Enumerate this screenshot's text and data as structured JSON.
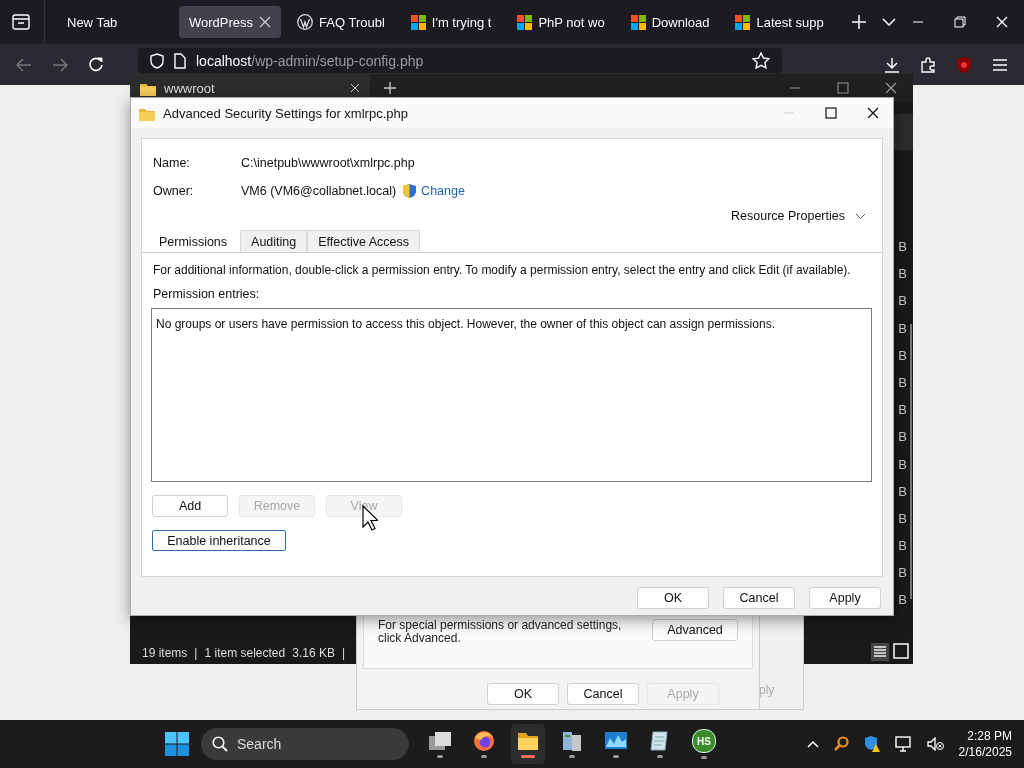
{
  "browser": {
    "tabs": [
      {
        "label": "New Tab",
        "selected": false,
        "kind": "plain"
      },
      {
        "label": "WordPress",
        "selected": true,
        "kind": "plain"
      },
      {
        "label": "FAQ Troubl",
        "selected": false,
        "kind": "wordpress"
      },
      {
        "label": "I'm trying t",
        "selected": false,
        "kind": "microsoft"
      },
      {
        "label": "PhP not wo",
        "selected": false,
        "kind": "microsoft"
      },
      {
        "label": "Download",
        "selected": false,
        "kind": "microsoft"
      },
      {
        "label": "Latest supp",
        "selected": false,
        "kind": "microsoft"
      }
    ],
    "url": {
      "host": "localhost",
      "path": "/wp-admin/setup-config.php"
    }
  },
  "explorer": {
    "tab_title": "wwwroot",
    "status": [
      "19 items",
      "1 item selected",
      "3.16 KB"
    ],
    "status_dividers": [
      "|",
      "|"
    ],
    "size_fragments": [
      "B",
      "B",
      "B",
      "B",
      "B",
      "B",
      "B",
      "B",
      "B",
      "B",
      "B",
      "B",
      "B",
      "B"
    ]
  },
  "dialog": {
    "title": "Advanced Security Settings for xmlrpc.php",
    "name_label": "Name:",
    "name_value": "C:\\inetpub\\wwwroot\\xmlrpc.php",
    "owner_label": "Owner:",
    "owner_value": "VM6 (VM6@collabnet.local)",
    "change_link": "Change",
    "resource_properties": "Resource Properties",
    "tabs": [
      {
        "label": "Permissions",
        "selected": true
      },
      {
        "label": "Auditing",
        "selected": false
      },
      {
        "label": "Effective Access",
        "selected": false
      }
    ],
    "info": "For additional information, double-click a permission entry. To modify a permission entry, select the entry and click Edit (if available).",
    "entries_label": "Permission entries:",
    "entries_message": "No groups or users have permission to access this object. However, the owner of this object can assign permissions.",
    "entry_buttons": [
      {
        "label": "Add",
        "disabled": false
      },
      {
        "label": "Remove",
        "disabled": true
      },
      {
        "label": "View",
        "disabled": true
      }
    ],
    "inheritance_button": "Enable inheritance",
    "footer_buttons": [
      {
        "label": "OK",
        "disabled": false
      },
      {
        "label": "Cancel",
        "disabled": false
      },
      {
        "label": "Apply",
        "disabled": false
      }
    ]
  },
  "properties_dialog": {
    "message": "For special permissions or advanced settings, click Advanced.",
    "advanced_button": "Advanced",
    "buttons": [
      {
        "label": "OK",
        "disabled": false
      },
      {
        "label": "Cancel",
        "disabled": false
      },
      {
        "label": "Apply",
        "disabled": true
      }
    ],
    "behind_fragment": "ply"
  },
  "taskbar": {
    "search_placeholder": "Search",
    "apps": [
      {
        "kind": "taskview",
        "active": false
      },
      {
        "kind": "firefox",
        "active": false
      },
      {
        "kind": "folder",
        "active": true
      },
      {
        "kind": "server",
        "active": false
      },
      {
        "kind": "monitor",
        "active": false
      },
      {
        "kind": "notepad",
        "active": false
      },
      {
        "kind": "badge",
        "label": "HS",
        "active": false
      }
    ],
    "time": "2:28 PM",
    "date": "2/16/2025"
  }
}
